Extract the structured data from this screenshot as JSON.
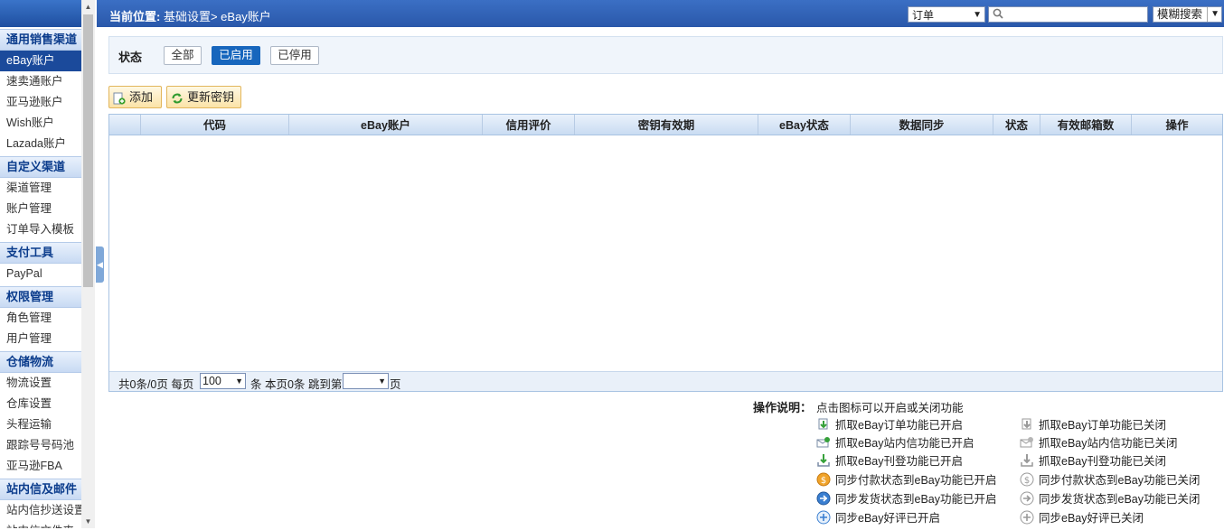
{
  "sidebar": {
    "groups": [
      {
        "title": "通用销售渠道",
        "items": [
          "eBay账户",
          "速卖通账户",
          "亚马逊账户",
          "Wish账户",
          "Lazada账户"
        ]
      },
      {
        "title": "自定义渠道",
        "items": [
          "渠道管理",
          "账户管理",
          "订单导入模板"
        ]
      },
      {
        "title": "支付工具",
        "items": [
          "PayPal"
        ]
      },
      {
        "title": "权限管理",
        "items": [
          "角色管理",
          "用户管理"
        ]
      },
      {
        "title": "仓储物流",
        "items": [
          "物流设置",
          "仓库设置",
          "头程运输",
          "跟踪号号码池",
          "亚马逊FBA"
        ]
      },
      {
        "title": "站内信及邮件",
        "items": [
          "站内信抄送设置",
          "站内信文件夹"
        ]
      }
    ],
    "active_item": "eBay账户"
  },
  "header": {
    "breadcrumb_prefix": "当前位置:",
    "breadcrumb_path": "基础设置> eBay账户",
    "search_type": "订单",
    "search_value": "",
    "fuzzy_search_label": "模糊搜索"
  },
  "status_filter": {
    "label": "状态",
    "options": [
      "全部",
      "已启用",
      "已停用"
    ],
    "selected": "已启用"
  },
  "toolbar": {
    "add_label": "添加",
    "refresh_key_label": "更新密钥"
  },
  "table": {
    "columns": [
      "",
      "代码",
      "eBay账户",
      "信用评价",
      "密钥有效期",
      "eBay状态",
      "数据同步",
      "状态",
      "有效邮箱数",
      "操作"
    ],
    "rows": []
  },
  "pager": {
    "summary": "共0条/0页 每页",
    "page_size": "100",
    "middle": "条 本页0条 跳到第",
    "jump_page": "",
    "suffix": "页"
  },
  "legend": {
    "title": "操作说明：",
    "description": "点击图标可以开启或关闭功能",
    "on_items": [
      "抓取eBay订单功能已开启",
      "抓取eBay站内信功能已开启",
      "抓取eBay刊登功能已开启",
      "同步付款状态到eBay功能已开启",
      "同步发货状态到eBay功能已开启",
      "同步eBay好评已开启"
    ],
    "off_items": [
      "抓取eBay订单功能已关闭",
      "抓取eBay站内信功能已关闭",
      "抓取eBay刊登功能已关闭",
      "同步付款状态到eBay功能已关闭",
      "同步发货状态到eBay功能已关闭",
      "同步eBay好评已关闭"
    ]
  },
  "colors": {
    "header_blue": "#2a58aa",
    "sidebar_active": "#1b4a9b",
    "status_selected": "#1766bd",
    "toolbar_button": "#fbe3a8"
  }
}
